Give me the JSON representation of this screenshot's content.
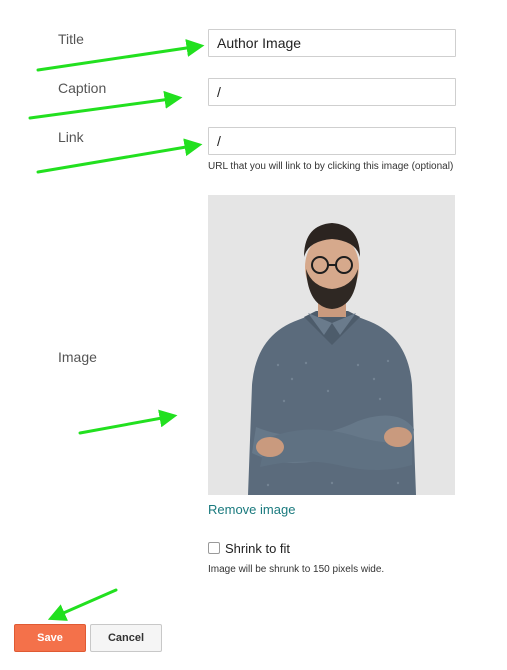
{
  "form": {
    "title": {
      "label": "Title",
      "value": "Author Image"
    },
    "caption": {
      "label": "Caption",
      "value": "/"
    },
    "link": {
      "label": "Link",
      "value": "/",
      "hint": "URL that you will link to by clicking this image (optional)"
    },
    "image": {
      "label": "Image",
      "remove_label": "Remove image"
    },
    "shrink": {
      "label": "Shrink to fit",
      "checked": false,
      "hint": "Image will be shrunk to 150 pixels wide."
    }
  },
  "actions": {
    "save_label": "Save",
    "cancel_label": "Cancel"
  },
  "colors": {
    "annotation_arrow": "#22e01f",
    "save_button": "#f4714a",
    "link_text": "#1a7a7e"
  }
}
